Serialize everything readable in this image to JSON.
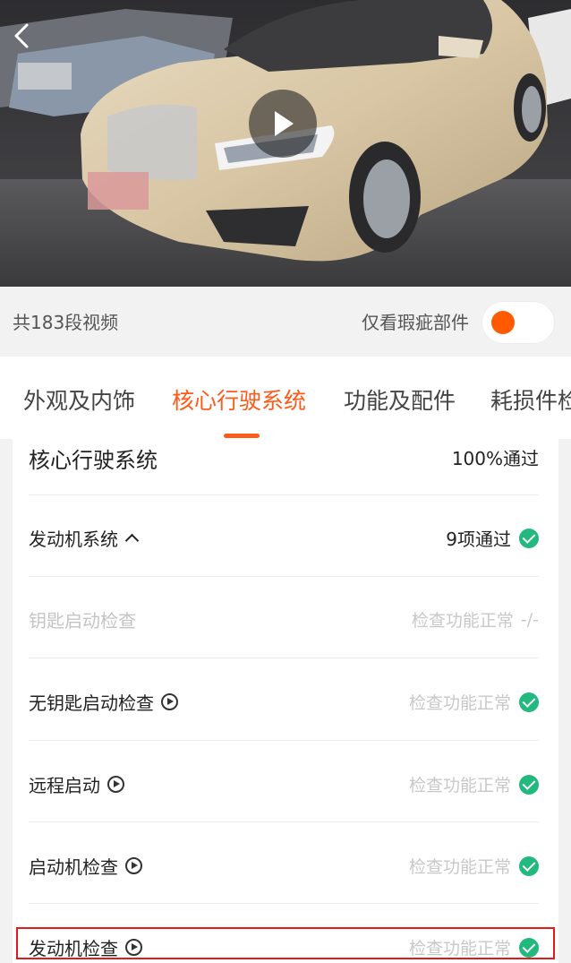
{
  "media": {
    "back_icon": "chevron-left-icon",
    "play_icon": "play-icon"
  },
  "video_bar": {
    "count_text": "共183段视频",
    "defect_only_label": "仅看瑕疵部件",
    "toggle_on": false
  },
  "tabs": [
    {
      "label": "外观及内饰",
      "active": false
    },
    {
      "label": "核心行驶系统",
      "active": true
    },
    {
      "label": "功能及配件",
      "active": false
    },
    {
      "label": "耗损件检",
      "active": false
    }
  ],
  "section": {
    "title": "核心行驶系统",
    "summary": "100%通过"
  },
  "group": {
    "label": "发动机系统",
    "status": "9项通过",
    "expanded": true
  },
  "items": [
    {
      "label": "钥匙启动检查",
      "status": "检查功能正常",
      "disabled": true,
      "has_video": false,
      "result": "-/-"
    },
    {
      "label": "无钥匙启动检查",
      "status": "检查功能正常",
      "disabled": false,
      "has_video": true,
      "result": "pass"
    },
    {
      "label": "远程启动",
      "status": "检查功能正常",
      "disabled": false,
      "has_video": true,
      "result": "pass"
    },
    {
      "label": "启动机检查",
      "status": "检查功能正常",
      "disabled": false,
      "has_video": true,
      "result": "pass"
    },
    {
      "label": "发动机检查",
      "status": "检查功能正常",
      "disabled": false,
      "has_video": true,
      "result": "pass"
    }
  ],
  "colors": {
    "accent": "#ff5a1a",
    "pass": "#21b97e",
    "highlight_border": "#e01b1b"
  }
}
